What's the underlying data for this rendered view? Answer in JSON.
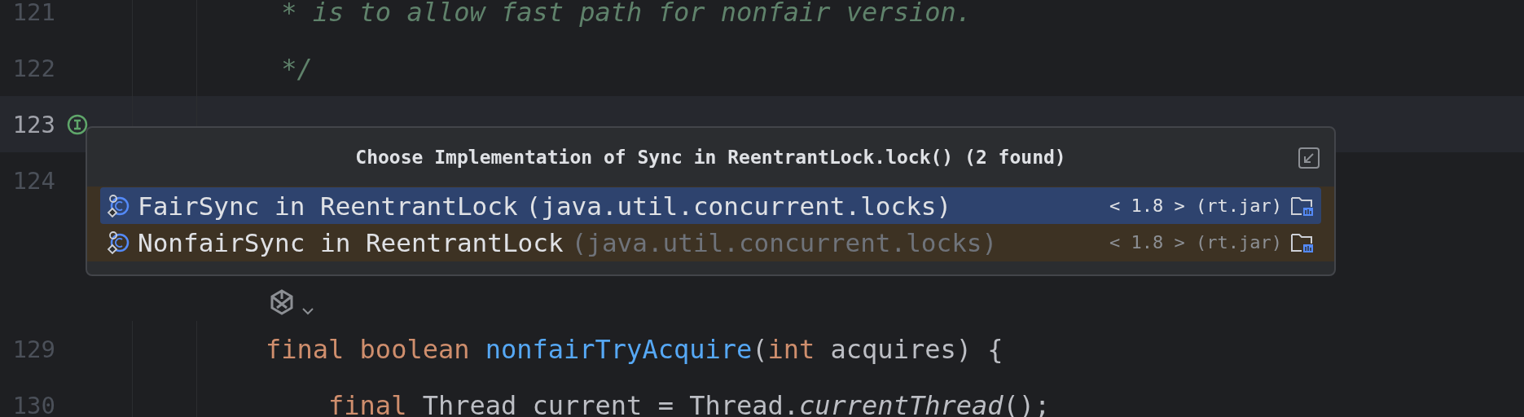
{
  "editor": {
    "lines": [
      {
        "kind": "code",
        "number": "121",
        "current": false,
        "tokens": [
          {
            "kind": "comment",
            "text": " * is to allow fast path for nonfair version."
          }
        ]
      },
      {
        "kind": "code",
        "number": "122",
        "current": false,
        "tokens": [
          {
            "kind": "comment",
            "text": " */"
          }
        ]
      },
      {
        "kind": "code",
        "number": "123",
        "current": true,
        "gutter_icon": {
          "kind": "implemented"
        }
      },
      {
        "kind": "code",
        "number": "124",
        "current": false
      },
      {
        "kind": "inlay"
      },
      {
        "kind": "code",
        "number": "129",
        "current": false,
        "tokens": [
          {
            "kind": "keyword",
            "text": "final boolean "
          },
          {
            "kind": "function",
            "text": "nonfairTryAcquire"
          },
          {
            "kind": "plain",
            "text": "("
          },
          {
            "kind": "keyword",
            "text": "int "
          },
          {
            "kind": "plain",
            "text": "acquires) {"
          }
        ]
      },
      {
        "kind": "code",
        "number": "130",
        "current": false,
        "tokens": [
          {
            "kind": "keyword",
            "text": "    final "
          },
          {
            "kind": "plain",
            "text": "Thread current = Thread."
          },
          {
            "kind": "italic",
            "text": "currentThread"
          },
          {
            "kind": "plain",
            "text": "();"
          }
        ]
      }
    ]
  },
  "popup": {
    "title": "Choose Implementation of Sync in ReentrantLock.lock() (2 found)",
    "items": [
      {
        "name": "FairSync in ReentrantLock",
        "package": "(java.util.concurrent.locks)",
        "library": "< 1.8 > (rt.jar)",
        "selected": true
      },
      {
        "name": "NonfairSync in ReentrantLock",
        "package": "(java.util.concurrent.locks)",
        "library": "< 1.8 > (rt.jar)",
        "selected": false
      }
    ]
  }
}
